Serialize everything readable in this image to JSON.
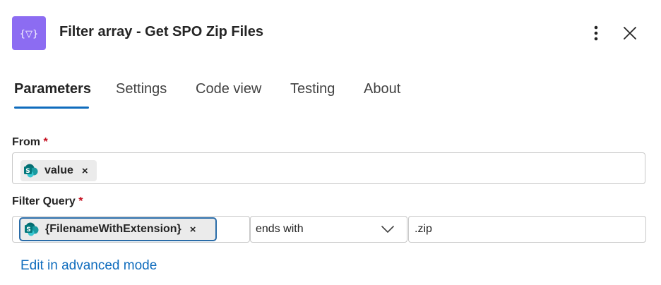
{
  "header": {
    "title": "Filter array - Get SPO Zip Files",
    "icon": "filter-array-icon",
    "icon_glyph": "{▽}",
    "accent_color": "#8c6cf2"
  },
  "tabs": [
    {
      "label": "Parameters",
      "active": true
    },
    {
      "label": "Settings",
      "active": false
    },
    {
      "label": "Code view",
      "active": false
    },
    {
      "label": "Testing",
      "active": false
    },
    {
      "label": "About",
      "active": false
    }
  ],
  "from": {
    "label": "From",
    "required_mark": "*",
    "token": {
      "label": "value",
      "icon": "sharepoint-icon",
      "remove": "×"
    }
  },
  "filter_query": {
    "label": "Filter Query",
    "required_mark": "*",
    "left_token": {
      "label": "{FilenameWithExtension}",
      "icon": "sharepoint-icon",
      "remove": "×"
    },
    "operator": "ends with",
    "value": ".zip"
  },
  "advanced_link": "Edit in advanced mode",
  "colors": {
    "link": "#0f6cbd",
    "required": "#c50f1f",
    "token_focus_border": "#2a6ca8"
  }
}
